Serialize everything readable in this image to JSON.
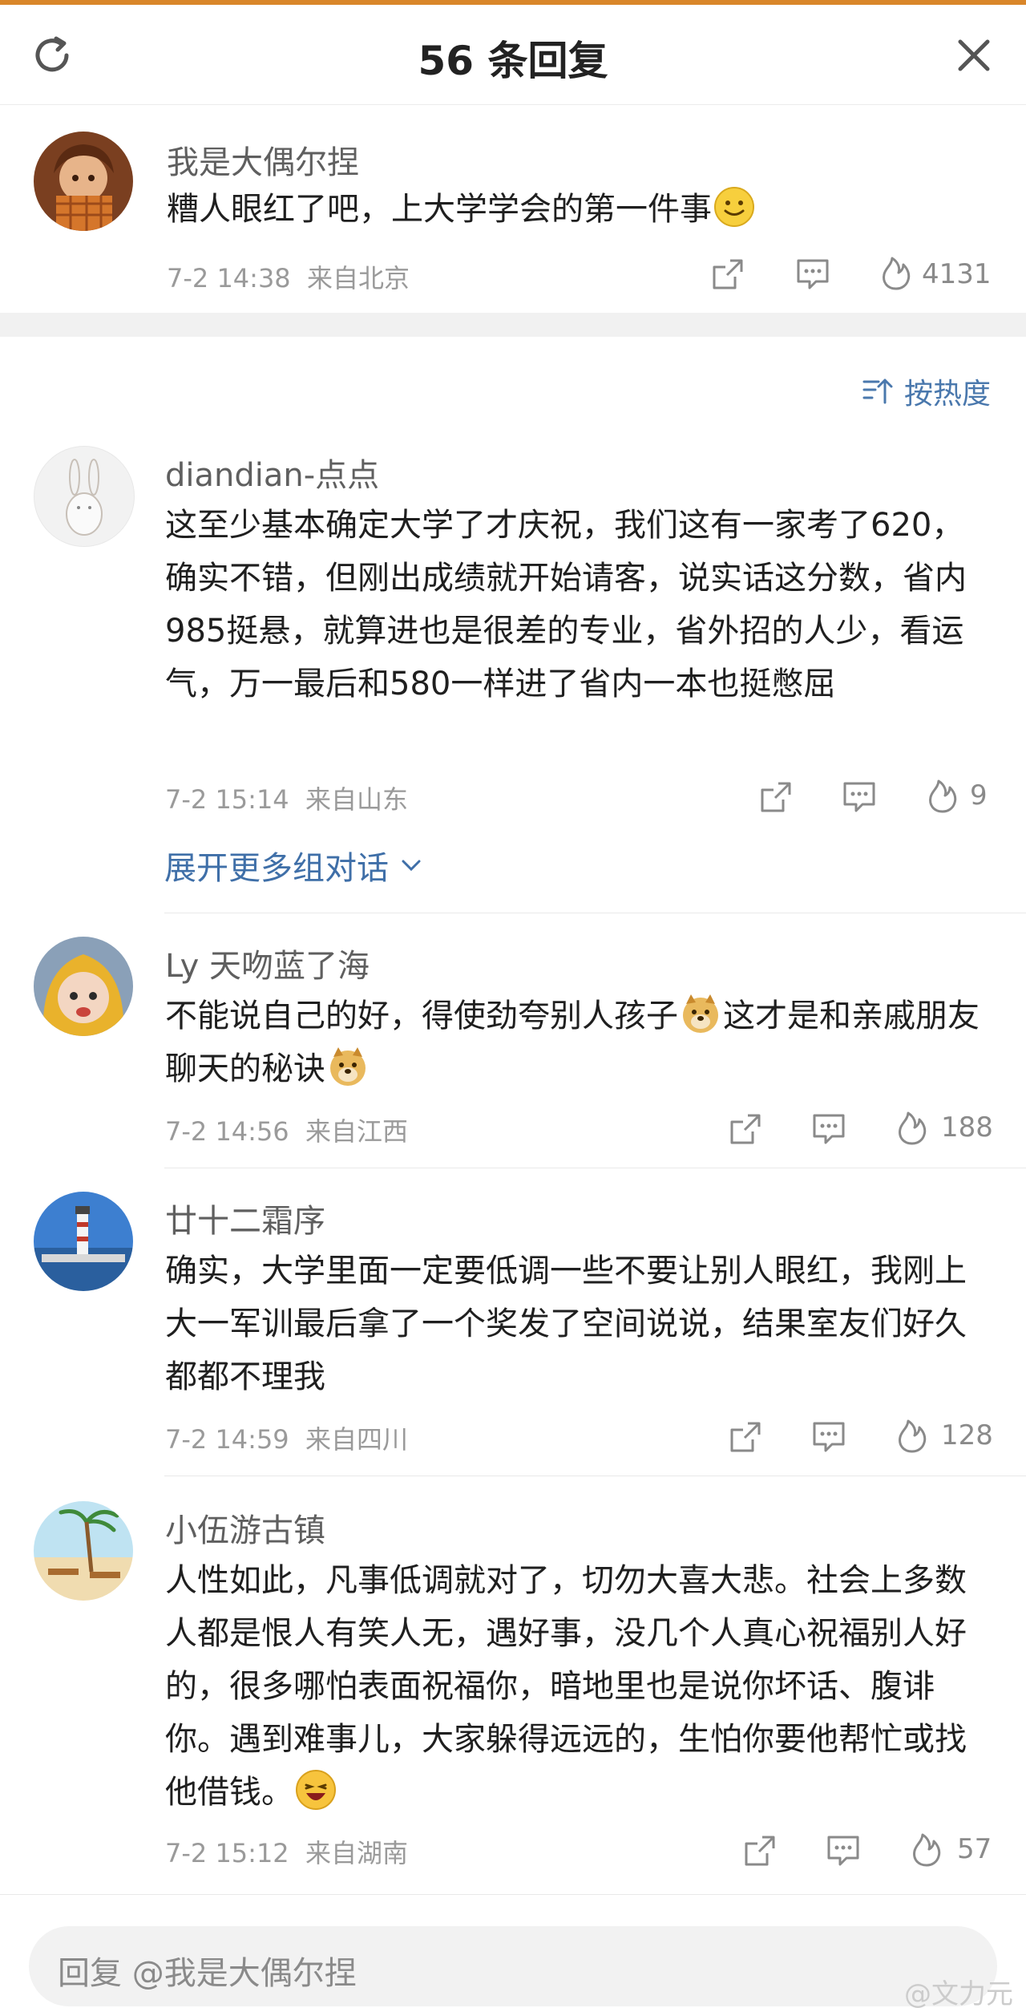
{
  "header": {
    "title": "56 条回复",
    "refresh_icon": "refresh-icon",
    "close_icon": "close-icon"
  },
  "main_comment": {
    "user": "我是大偶尔捏",
    "text": "糟人眼红了吧，上大学学会的第一件事",
    "time": "7-2 14:38",
    "location": "来自北京",
    "likes": "4131"
  },
  "sort": {
    "label": "按热度"
  },
  "replies": [
    {
      "user": "diandian-点点",
      "text": "这至少基本确定大学了才庆祝，我们这有一家考了620，确实不错，但刚出成绩就开始请客，说实话这分数，省内985挺悬，就算进也是很差的专业，省外招的人少，看运气，万一最后和580一样进了省内一本也挺憋屈",
      "time": "7-2 15:14",
      "location": "来自山东",
      "likes": "9"
    },
    {
      "user": "Ly 天吻蓝了海",
      "text_a": "不能说自己的好，得使劲夸别人孩子",
      "text_b": "这才是和亲戚朋友聊天的秘诀",
      "time": "7-2 14:56",
      "location": "来自江西",
      "likes": "188"
    },
    {
      "user": "廿十二霜序",
      "text": "确实，大学里面一定要低调一些不要让别人眼红，我刚上大一军训最后拿了一个奖发了空间说说，结果室友们好久都都不理我",
      "time": "7-2 14:59",
      "location": "来自四川",
      "likes": "128"
    },
    {
      "user": "小伍游古镇",
      "text": "人性如此，凡事低调就对了，切勿大喜大悲。社会上多数人都是恨人有笑人无，遇好事，没几个人真心祝福别人好的，很多哪怕表面祝福你，暗地里也是说你坏话、腹诽你。遇到难事儿，大家躲得远远的，生怕你要他帮忙或找他借钱。",
      "time": "7-2 15:12",
      "location": "来自湖南",
      "likes": "57"
    }
  ],
  "expand": {
    "label": "展开更多组对话"
  },
  "reply_bar": {
    "placeholder": "回复 @我是大偶尔捏"
  },
  "watermark": "@文力元",
  "colors": {
    "accent": "#4a78ad",
    "meta": "#9a9a9a",
    "top_strip": "#d9862a"
  }
}
